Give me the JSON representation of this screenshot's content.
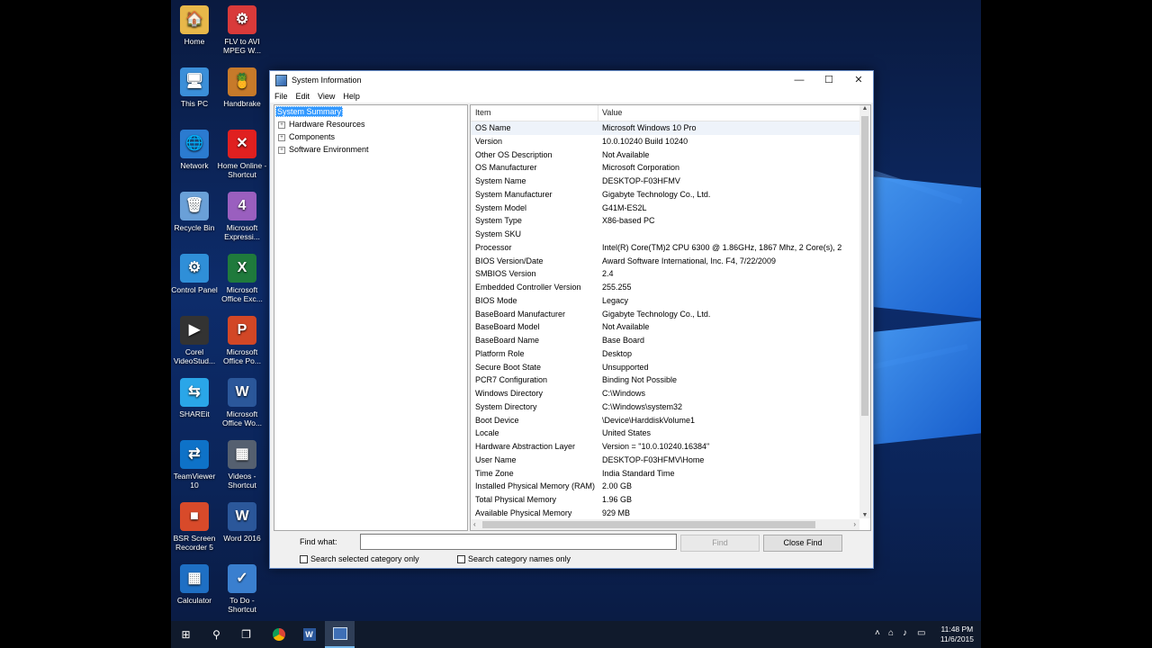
{
  "desktop": {
    "icons": [
      {
        "label": "Home",
        "icon": "folder-user-icon",
        "color": "#e8b84a",
        "glyph": "🏠"
      },
      {
        "label": "FLV to AVI MPEG W...",
        "icon": "converter-icon",
        "color": "#d93a3a",
        "glyph": "⚙"
      },
      {
        "label": "This PC",
        "icon": "computer-icon",
        "color": "#3b8fd9",
        "glyph": "🖥"
      },
      {
        "label": "Handbrake",
        "icon": "handbrake-icon",
        "color": "#c77a2a",
        "glyph": "🍍"
      },
      {
        "label": "Network",
        "icon": "network-icon",
        "color": "#2b7bd0",
        "glyph": "🌐"
      },
      {
        "label": "Home Online - Shortcut",
        "icon": "error-x-icon",
        "color": "#e02020",
        "glyph": "✕"
      },
      {
        "label": "Recycle Bin",
        "icon": "recycle-bin-icon",
        "color": "#6aa0d8",
        "glyph": "🗑"
      },
      {
        "label": "Microsoft Expressi...",
        "icon": "expression-icon",
        "color": "#9a5fbf",
        "glyph": "4"
      },
      {
        "label": "Control Panel",
        "icon": "control-panel-icon",
        "color": "#2f8fd8",
        "glyph": "⚙"
      },
      {
        "label": "Microsoft Office Exc...",
        "icon": "excel-icon",
        "color": "#1f7a3c",
        "glyph": "X"
      },
      {
        "label": "Corel VideoStud...",
        "icon": "corel-icon",
        "color": "#333333",
        "glyph": "▶"
      },
      {
        "label": "Microsoft Office Po...",
        "icon": "powerpoint-icon",
        "color": "#d24726",
        "glyph": "P"
      },
      {
        "label": "SHAREit",
        "icon": "shareit-icon",
        "color": "#2aa6e8",
        "glyph": "⇆"
      },
      {
        "label": "Microsoft Office Wo...",
        "icon": "word-icon",
        "color": "#2b579a",
        "glyph": "W"
      },
      {
        "label": "TeamViewer 10",
        "icon": "teamviewer-icon",
        "color": "#0e72c8",
        "glyph": "⇄"
      },
      {
        "label": "Videos - Shortcut",
        "icon": "videos-icon",
        "color": "#556070",
        "glyph": "▦"
      },
      {
        "label": "BSR Screen Recorder 5",
        "icon": "bsr-icon",
        "color": "#d84a2a",
        "glyph": "■"
      },
      {
        "label": "Word 2016",
        "icon": "word-icon",
        "color": "#2b579a",
        "glyph": "W"
      },
      {
        "label": "Calculator",
        "icon": "calculator-icon",
        "color": "#1e6fc4",
        "glyph": "▦"
      },
      {
        "label": "To Do - Shortcut",
        "icon": "todo-icon",
        "color": "#3a7fcf",
        "glyph": "✓"
      }
    ]
  },
  "window": {
    "title": "System Information",
    "controls": {
      "minimize": "—",
      "maximize": "☐",
      "close": "✕"
    },
    "menu": [
      "File",
      "Edit",
      "View",
      "Help"
    ],
    "tree": {
      "selected": "System Summary",
      "children": [
        "Hardware Resources",
        "Components",
        "Software Environment"
      ]
    },
    "grid": {
      "col_item": "Item",
      "col_value": "Value",
      "rows": [
        [
          "OS Name",
          "Microsoft Windows 10 Pro"
        ],
        [
          "Version",
          "10.0.10240 Build 10240"
        ],
        [
          "Other OS Description",
          "Not Available"
        ],
        [
          "OS Manufacturer",
          "Microsoft Corporation"
        ],
        [
          "System Name",
          "DESKTOP-F03HFMV"
        ],
        [
          "System Manufacturer",
          "Gigabyte Technology Co., Ltd."
        ],
        [
          "System Model",
          "G41M-ES2L"
        ],
        [
          "System Type",
          "X86-based PC"
        ],
        [
          "System SKU",
          ""
        ],
        [
          "Processor",
          "Intel(R) Core(TM)2 CPU        6300  @ 1.86GHz, 1867 Mhz, 2 Core(s), 2"
        ],
        [
          "BIOS Version/Date",
          "Award Software International, Inc. F4, 7/22/2009"
        ],
        [
          "SMBIOS Version",
          "2.4"
        ],
        [
          "Embedded Controller Version",
          "255.255"
        ],
        [
          "BIOS Mode",
          "Legacy"
        ],
        [
          "BaseBoard Manufacturer",
          "Gigabyte Technology Co., Ltd."
        ],
        [
          "BaseBoard Model",
          "Not Available"
        ],
        [
          "BaseBoard Name",
          "Base Board"
        ],
        [
          "Platform Role",
          "Desktop"
        ],
        [
          "Secure Boot State",
          "Unsupported"
        ],
        [
          "PCR7 Configuration",
          "Binding Not Possible"
        ],
        [
          "Windows Directory",
          "C:\\Windows"
        ],
        [
          "System Directory",
          "C:\\Windows\\system32"
        ],
        [
          "Boot Device",
          "\\Device\\HarddiskVolume1"
        ],
        [
          "Locale",
          "United States"
        ],
        [
          "Hardware Abstraction Layer",
          "Version = \"10.0.10240.16384\""
        ],
        [
          "User Name",
          "DESKTOP-F03HFMV\\Home"
        ],
        [
          "Time Zone",
          "India Standard Time"
        ],
        [
          "Installed Physical Memory (RAM)",
          "2.00 GB"
        ],
        [
          "Total Physical Memory",
          "1.96 GB"
        ],
        [
          "Available Physical Memory",
          "929 MB"
        ]
      ]
    },
    "find": {
      "label": "Find what:",
      "value": "",
      "find_button": "Find",
      "close_button": "Close Find",
      "check1": "Search selected category only",
      "check2": "Search category names only"
    }
  },
  "taskbar": {
    "time": "11:48 PM",
    "date": "11/6/2015"
  }
}
